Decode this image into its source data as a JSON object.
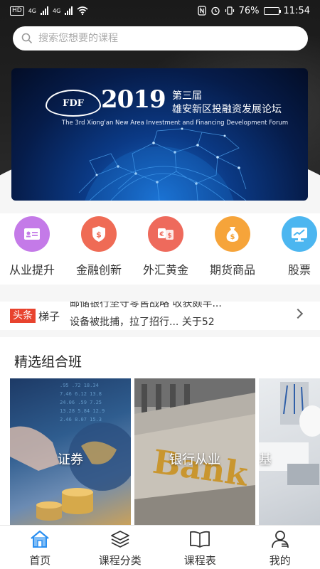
{
  "status_bar": {
    "network_badge": "HD",
    "signal_labels": [
      "4G",
      "4G"
    ],
    "battery": "76%",
    "battery_level": 0.76,
    "time": "11:54"
  },
  "search": {
    "placeholder": "搜索您想要的课程"
  },
  "banner": {
    "logo_text": "FDF",
    "year": "2019",
    "title_line1": "第三届",
    "title_line2": "雄安新区投融资发展论坛",
    "subtitle": "The 3rd Xiong'an New Area Investment and Financing Development Forum"
  },
  "categories": [
    {
      "label": "从业提升",
      "icon": "id-card-icon",
      "color": "#c47ae8"
    },
    {
      "label": "金融创新",
      "icon": "money-shield-icon",
      "color": "#ef6b55"
    },
    {
      "label": "外汇黄金",
      "icon": "exchange-icon",
      "color": "#ee6a5c"
    },
    {
      "label": "期货商品",
      "icon": "money-bag-icon",
      "color": "#f6a43a"
    },
    {
      "label": "股票",
      "icon": "trend-chart-icon",
      "color": "#4cb6f0"
    }
  ],
  "headline": {
    "tag": "头条",
    "source": "梯子",
    "line1": "邮储银行坚守零售战略 收获颇丰...",
    "line2": "设备被批捕，拉了招行... 关于52"
  },
  "featured": {
    "section_title": "精选组合班",
    "cards": [
      {
        "label": "证券"
      },
      {
        "label": "银行从业"
      },
      {
        "label": "基"
      }
    ]
  },
  "tabbar": [
    {
      "label": "首页",
      "icon": "home-icon",
      "active": true
    },
    {
      "label": "课程分类",
      "icon": "layers-icon",
      "active": false
    },
    {
      "label": "课程表",
      "icon": "book-icon",
      "active": false
    },
    {
      "label": "我的",
      "icon": "user-icon",
      "active": false
    }
  ],
  "colors": {
    "accent": "#2b8ff0",
    "headline_tag": "#e8432e"
  }
}
